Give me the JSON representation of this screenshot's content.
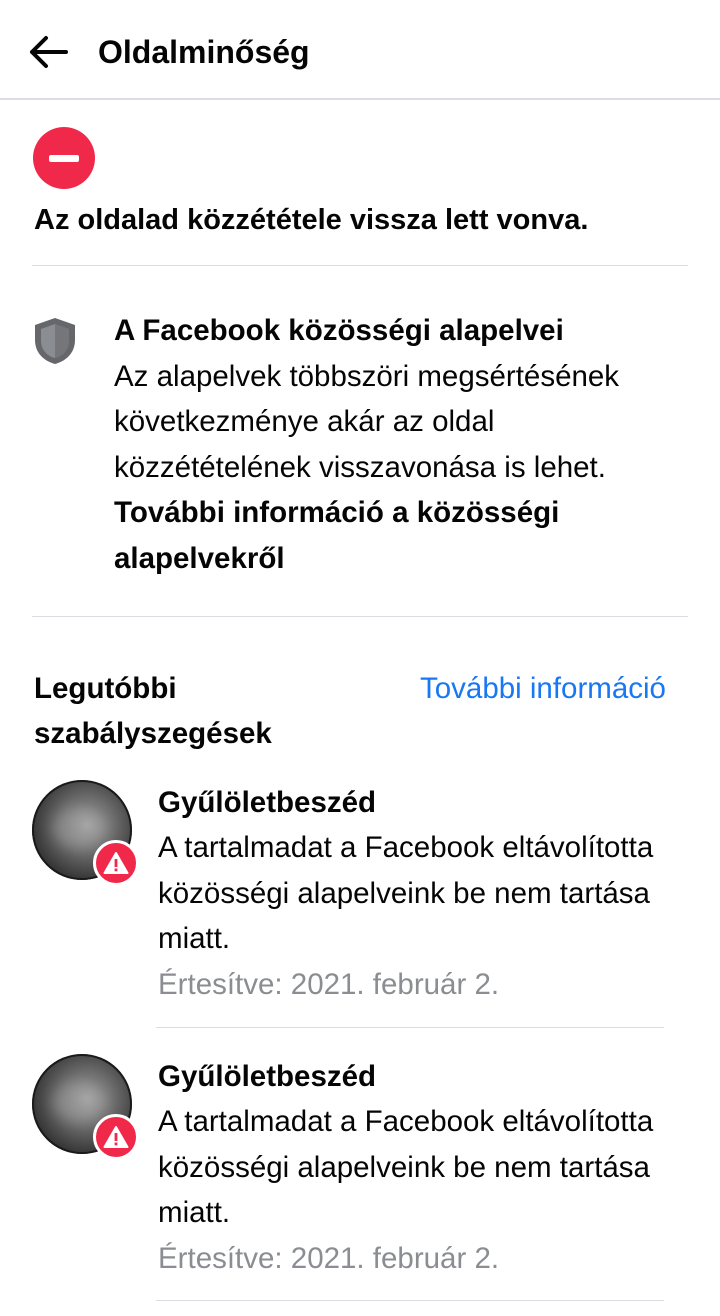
{
  "header": {
    "title": "Oldalminőség",
    "back_icon": "arrow-left-icon"
  },
  "status": {
    "icon": "minus-circle-icon",
    "color": "#f02849",
    "text": "Az oldalad közzététele vissza lett vonva."
  },
  "standards": {
    "icon": "shield-icon",
    "title": "A Facebook közösségi alapelvei",
    "body": "Az alapelvek többszöri megsértésének következménye akár az oldal közzétételének visszavonása is lehet.",
    "link": "További információ a közösségi alapelvekről"
  },
  "recent": {
    "title": "Legutóbbi szabályszegések",
    "more_link": "További információ",
    "link_color": "#1877f2",
    "violations": [
      {
        "title": "Gyűlöletbeszéd",
        "description": "A tartalmadat a Facebook eltávolította közösségi alapelveink be nem tartása miatt.",
        "date": "Értesítve: 2021. február 2.",
        "badge_icon": "warning-triangle-icon"
      },
      {
        "title": "Gyűlöletbeszéd",
        "description": "A tartalmadat a Facebook eltávolította közösségi alapelveink be nem tartása miatt.",
        "date": "Értesítve: 2021. február 2.",
        "badge_icon": "warning-triangle-icon"
      }
    ]
  }
}
